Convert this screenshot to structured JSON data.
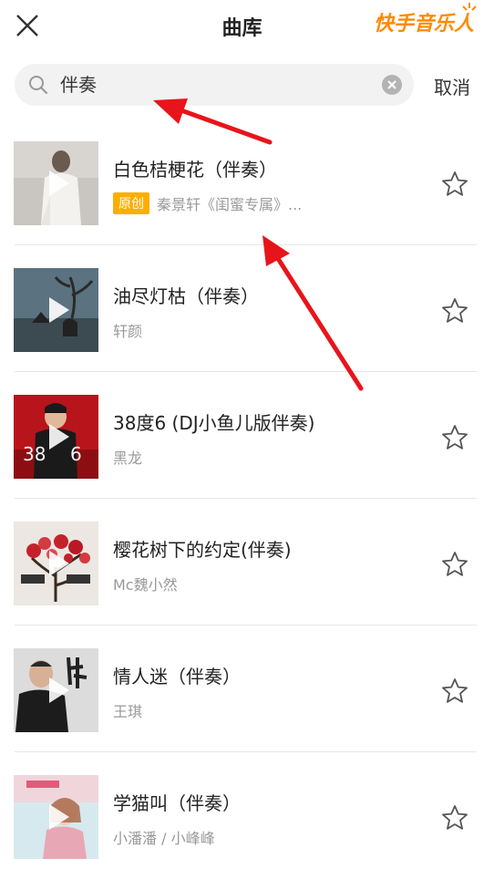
{
  "header": {
    "title": "曲库",
    "brand": "快手音乐人"
  },
  "search": {
    "value": "伴奏",
    "cancel_label": "取消"
  },
  "songs": [
    {
      "title": "白色桔梗花（伴奏）",
      "badge": "原创",
      "artist": "秦景轩《闺蜜专属》..."
    },
    {
      "title": "油尽灯枯（伴奏）",
      "artist": "轩颜"
    },
    {
      "title": "38度6 (DJ小鱼儿版伴奏)",
      "artist": "黑龙"
    },
    {
      "title": "樱花树下的约定(伴奏)",
      "artist": "Mc魏小然"
    },
    {
      "title": "情人迷（伴奏）",
      "artist": "王琪"
    },
    {
      "title": "学猫叫（伴奏）",
      "artist": "小潘潘 / 小峰峰"
    }
  ],
  "colors": {
    "accent": "#ffae00",
    "brand": "#ff8a00",
    "annotation_arrow": "#e8141b"
  }
}
